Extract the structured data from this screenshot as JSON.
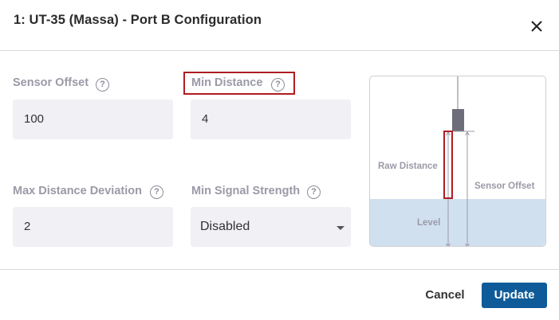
{
  "dialog": {
    "title": "1: UT-35 (Massa) - Port B Configuration"
  },
  "fields": {
    "sensor_offset": {
      "label": "Sensor Offset",
      "value": "100"
    },
    "min_distance": {
      "label": "Min Distance",
      "value": "4"
    },
    "max_distance_deviation": {
      "label": "Max Distance Deviation",
      "value": "2"
    },
    "min_signal_strength": {
      "label": "Min Signal Strength",
      "selected": "Disabled"
    }
  },
  "help_glyph": "?",
  "diagram": {
    "raw_distance_label": "Raw Distance",
    "sensor_offset_label": "Sensor Offset",
    "level_label": "Level",
    "colors": {
      "level_fill": "#d1e0ee",
      "sensor": "#6e6e7a",
      "highlight": "#b01c22"
    }
  },
  "footer": {
    "cancel_label": "Cancel",
    "update_label": "Update"
  },
  "colors": {
    "primary": "#0f5b99",
    "input_bg": "#f0f0f5",
    "highlight": "#b01c22"
  }
}
